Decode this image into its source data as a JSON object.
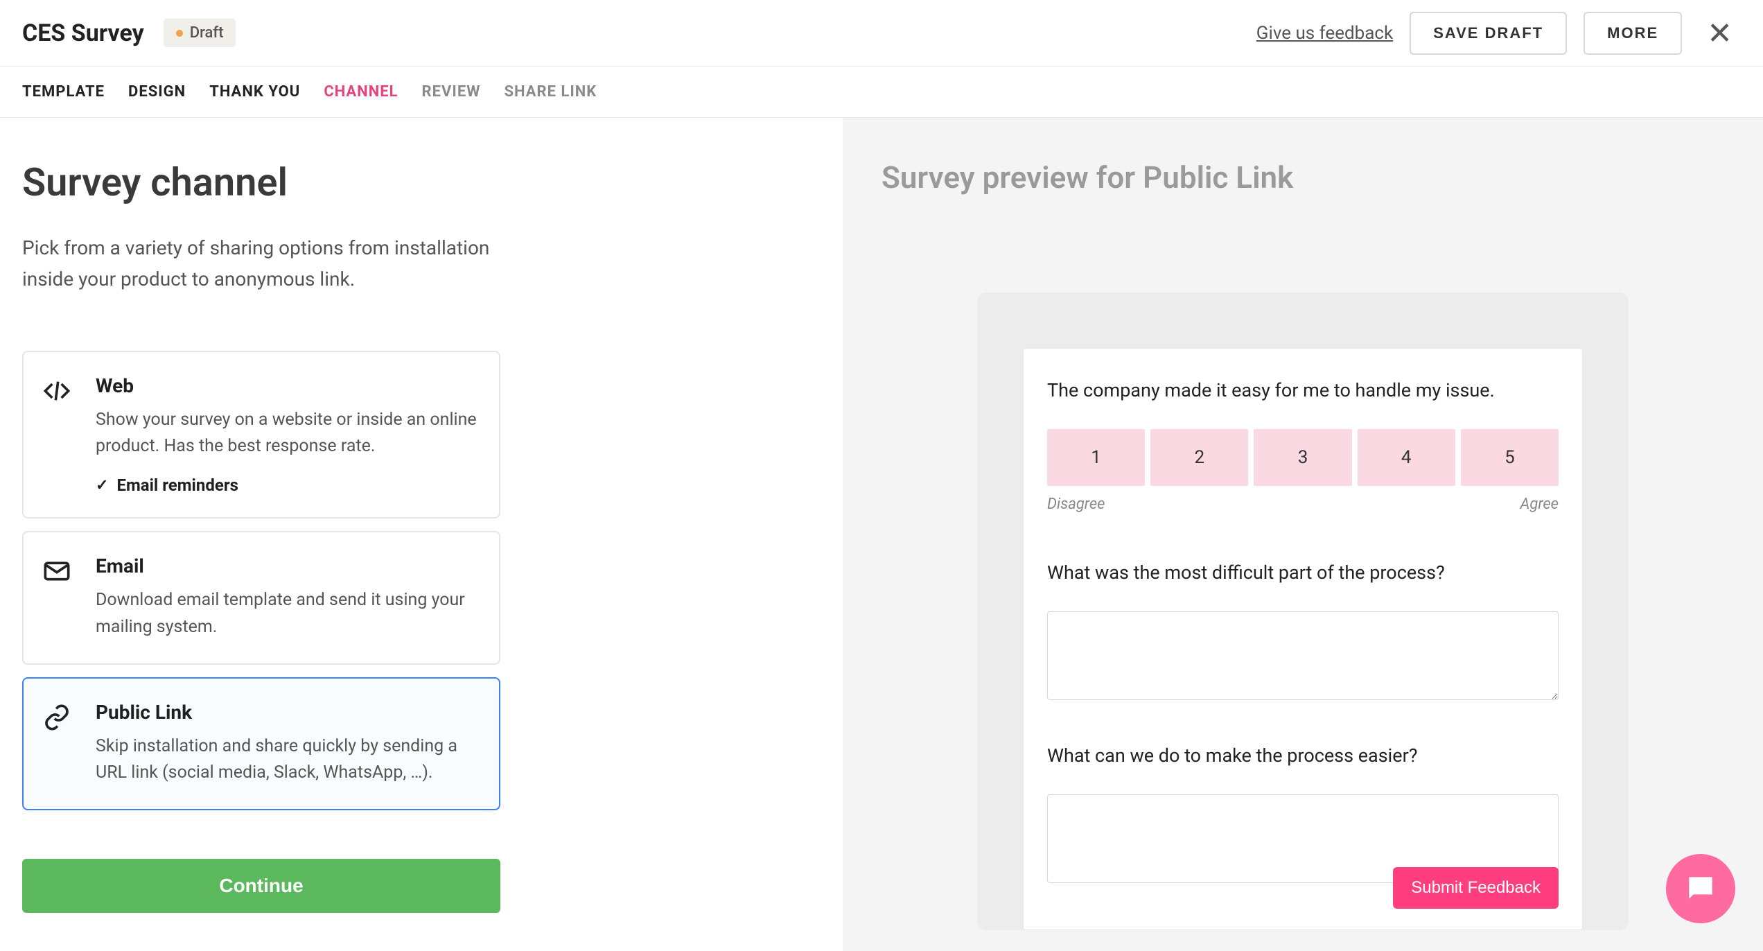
{
  "header": {
    "title": "CES Survey",
    "badge": "Draft",
    "feedback": "Give us feedback",
    "save": "SAVE DRAFT",
    "more": "MORE"
  },
  "tabs": [
    {
      "label": "TEMPLATE",
      "state": "normal"
    },
    {
      "label": "DESIGN",
      "state": "normal"
    },
    {
      "label": "THANK YOU",
      "state": "normal"
    },
    {
      "label": "CHANNEL",
      "state": "active"
    },
    {
      "label": "REVIEW",
      "state": "muted"
    },
    {
      "label": "SHARE LINK",
      "state": "muted"
    }
  ],
  "left": {
    "title": "Survey channel",
    "subtitle": "Pick from a variety of sharing options from installation inside your product to anonymous link.",
    "continue": "Continue"
  },
  "channels": [
    {
      "id": "web",
      "title": "Web",
      "desc": "Show your survey on a website or inside an online product. Has the best response rate.",
      "feature": "Email reminders",
      "selected": false
    },
    {
      "id": "email",
      "title": "Email",
      "desc": "Download email template and send it using your mailing system.",
      "selected": false
    },
    {
      "id": "public",
      "title": "Public Link",
      "desc": "Skip installation and share quickly by sending a URL link (social media, Slack, WhatsApp, …).",
      "selected": true
    }
  ],
  "preview": {
    "title": "Survey preview for Public Link",
    "q1": "The company made it easy for me to handle my issue.",
    "scale": [
      "1",
      "2",
      "3",
      "4",
      "5"
    ],
    "scale_low": "Disagree",
    "scale_high": "Agree",
    "q2": "What was the most difficult part of the process?",
    "q3": "What can we do to make the process easier?",
    "submit": "Submit Feedback"
  },
  "colors": {
    "accent_pink": "#e9427c",
    "button_green": "#5cb85c",
    "scale_pink": "#fbd9e3",
    "submit_pink": "#ff3e7f",
    "fab_pink": "#ff6aa0",
    "selected_blue": "#3b82f6"
  }
}
